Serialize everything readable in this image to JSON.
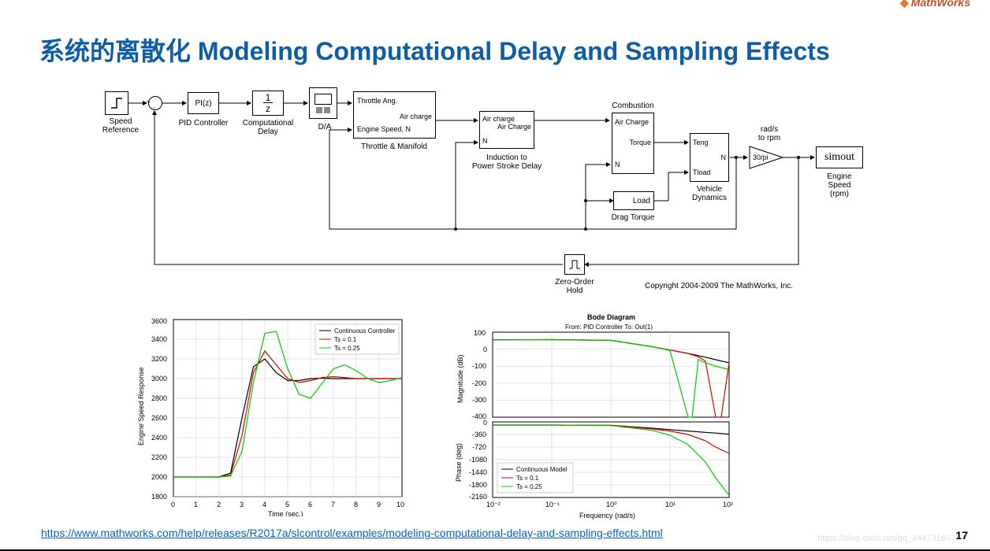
{
  "brand": "MathWorks",
  "title": "系统的离散化 Modeling Computational Delay and Sampling Effects",
  "page_number": "17",
  "watermark": "https://blog.csdn.net/qq_34473160",
  "footer_link": "https://www.mathworks.com/help/releases/R2017a/slcontrol/examples/modeling-computational-delay-and-sampling-effects.html",
  "copyright": "Copyright 2004-2009 The MathWorks, Inc.",
  "diagram": {
    "speed_ref_label": "Speed\nReference",
    "pid_block": "PI(z)",
    "pid_label": "PID Controller",
    "delay_block": "1/z",
    "delay_label": "Computational\nDelay",
    "da_label": "D/A",
    "tm_block": {
      "in1": "Throttle Ang.",
      "out": "Air charge",
      "in2": "Engine Speed, N",
      "label": "Throttle & Manifold"
    },
    "ind_block": {
      "in1": "Air charge",
      "out": "Air Charge",
      "in2": "N",
      "label": "Induction to\nPower Stroke Delay"
    },
    "combust_block": {
      "label": "Combustion",
      "in1": "Air Charge",
      "out": "Torque",
      "in2": "N"
    },
    "load_block": "Load",
    "drag_label": "Drag Torque",
    "veh_block": {
      "in1": "Teng",
      "out": "N",
      "in2": "Tload",
      "label": "Vehicle\nDynamics"
    },
    "gain_block": "30/pi",
    "gain_label": "rad/s\nto rpm",
    "simout": "simout",
    "simout_label": "Engine\nSpeed\n(rpm)",
    "zoh_label": "Zero-Order\nHold"
  },
  "chart1": {
    "ylabel": "Engine Speed Response",
    "xlabel": "Time (sec.)",
    "legend": [
      "Continuous Controller",
      "Ts = 0.1",
      "Ts = 0.25"
    ],
    "x_ticks": [
      0,
      1,
      2,
      3,
      4,
      5,
      6,
      7,
      8,
      9,
      10
    ],
    "y_ticks": [
      1800,
      2000,
      2200,
      2400,
      2600,
      2800,
      3000,
      3200,
      3400,
      3600
    ]
  },
  "chart2": {
    "title": "Bode Diagram",
    "subtitle": "From: PID Controller  To: Out(1)",
    "mag_label": "Magnitude (dB)",
    "phase_label": "Phase (deg)",
    "xlabel": "Frequency  (rad/s)",
    "mag_ticks": [
      100,
      0,
      -100,
      -200,
      -300,
      -400
    ],
    "phase_ticks": [
      0,
      -360,
      -720,
      -1080,
      -1440,
      -1800,
      -2160
    ],
    "x_ticks": [
      "10⁻²",
      "10⁻¹",
      "10⁰",
      "10¹",
      "10²"
    ],
    "legend": [
      "Continuous Model",
      "Ts = 0.1",
      "Ts = 0.25"
    ]
  },
  "chart_data": [
    {
      "type": "line",
      "title": "Engine Speed Response",
      "xlabel": "Time (sec.)",
      "ylabel": "Engine Speed Response",
      "xlim": [
        0,
        10
      ],
      "ylim": [
        1800,
        3600
      ],
      "x": [
        0,
        1,
        2,
        2.5,
        3,
        3.5,
        4,
        4.5,
        5,
        5.5,
        6,
        6.5,
        7,
        7.5,
        8,
        8.5,
        9,
        9.5,
        10
      ],
      "series": [
        {
          "name": "Continuous Controller",
          "color": "#000",
          "values": [
            2000,
            2000,
            2000,
            2040,
            2600,
            3120,
            3200,
            3060,
            2980,
            2980,
            3000,
            3005,
            3000,
            3000,
            3000,
            3000,
            3000,
            3000,
            3000
          ]
        },
        {
          "name": "Ts = 0.1",
          "color": "#d00",
          "values": [
            2000,
            2000,
            2000,
            2020,
            2420,
            3060,
            3280,
            3140,
            3000,
            2960,
            2980,
            3010,
            3020,
            3010,
            3000,
            3000,
            3000,
            3000,
            3000
          ]
        },
        {
          "name": "Ts = 0.25",
          "color": "#0c0",
          "values": [
            2000,
            2000,
            2000,
            2010,
            2260,
            2960,
            3460,
            3480,
            3100,
            2840,
            2800,
            2950,
            3100,
            3140,
            3080,
            3000,
            2960,
            2980,
            3010
          ]
        }
      ]
    },
    {
      "type": "line",
      "title": "Bode Diagram - Magnitude",
      "xlabel": "Frequency (rad/s)",
      "ylabel": "Magnitude (dB)",
      "xscale": "log",
      "xlim": [
        0.01,
        100
      ],
      "ylim": [
        -400,
        100
      ],
      "x": [
        0.01,
        0.1,
        1,
        5,
        10,
        20,
        30,
        40,
        60,
        100
      ],
      "series": [
        {
          "name": "Continuous Model",
          "color": "#000",
          "values": [
            55,
            56,
            52,
            15,
            -5,
            -25,
            -38,
            -47,
            -62,
            -80
          ]
        },
        {
          "name": "Ts = 0.1",
          "color": "#d00",
          "values": [
            55,
            56,
            52,
            15,
            -5,
            -25,
            -45,
            -70,
            -400,
            -80
          ]
        },
        {
          "name": "Ts = 0.25",
          "color": "#0c0",
          "values": [
            55,
            56,
            52,
            15,
            -8,
            -400,
            -60,
            -80,
            -100,
            -120
          ]
        }
      ]
    },
    {
      "type": "line",
      "title": "Bode Diagram - Phase",
      "xlabel": "Frequency (rad/s)",
      "ylabel": "Phase (deg)",
      "xscale": "log",
      "xlim": [
        0.01,
        100
      ],
      "ylim": [
        -2160,
        0
      ],
      "x": [
        0.01,
        0.1,
        1,
        5,
        10,
        20,
        40,
        60,
        100
      ],
      "series": [
        {
          "name": "Continuous Model",
          "color": "#000",
          "values": [
            -90,
            -90,
            -100,
            -180,
            -220,
            -260,
            -300,
            -320,
            -350
          ]
        },
        {
          "name": "Ts = 0.1",
          "color": "#d00",
          "values": [
            -90,
            -90,
            -100,
            -200,
            -260,
            -360,
            -540,
            -720,
            -900
          ]
        },
        {
          "name": "Ts = 0.25",
          "color": "#0c0",
          "values": [
            -90,
            -90,
            -105,
            -240,
            -380,
            -650,
            -1150,
            -1600,
            -2100
          ]
        }
      ]
    }
  ]
}
